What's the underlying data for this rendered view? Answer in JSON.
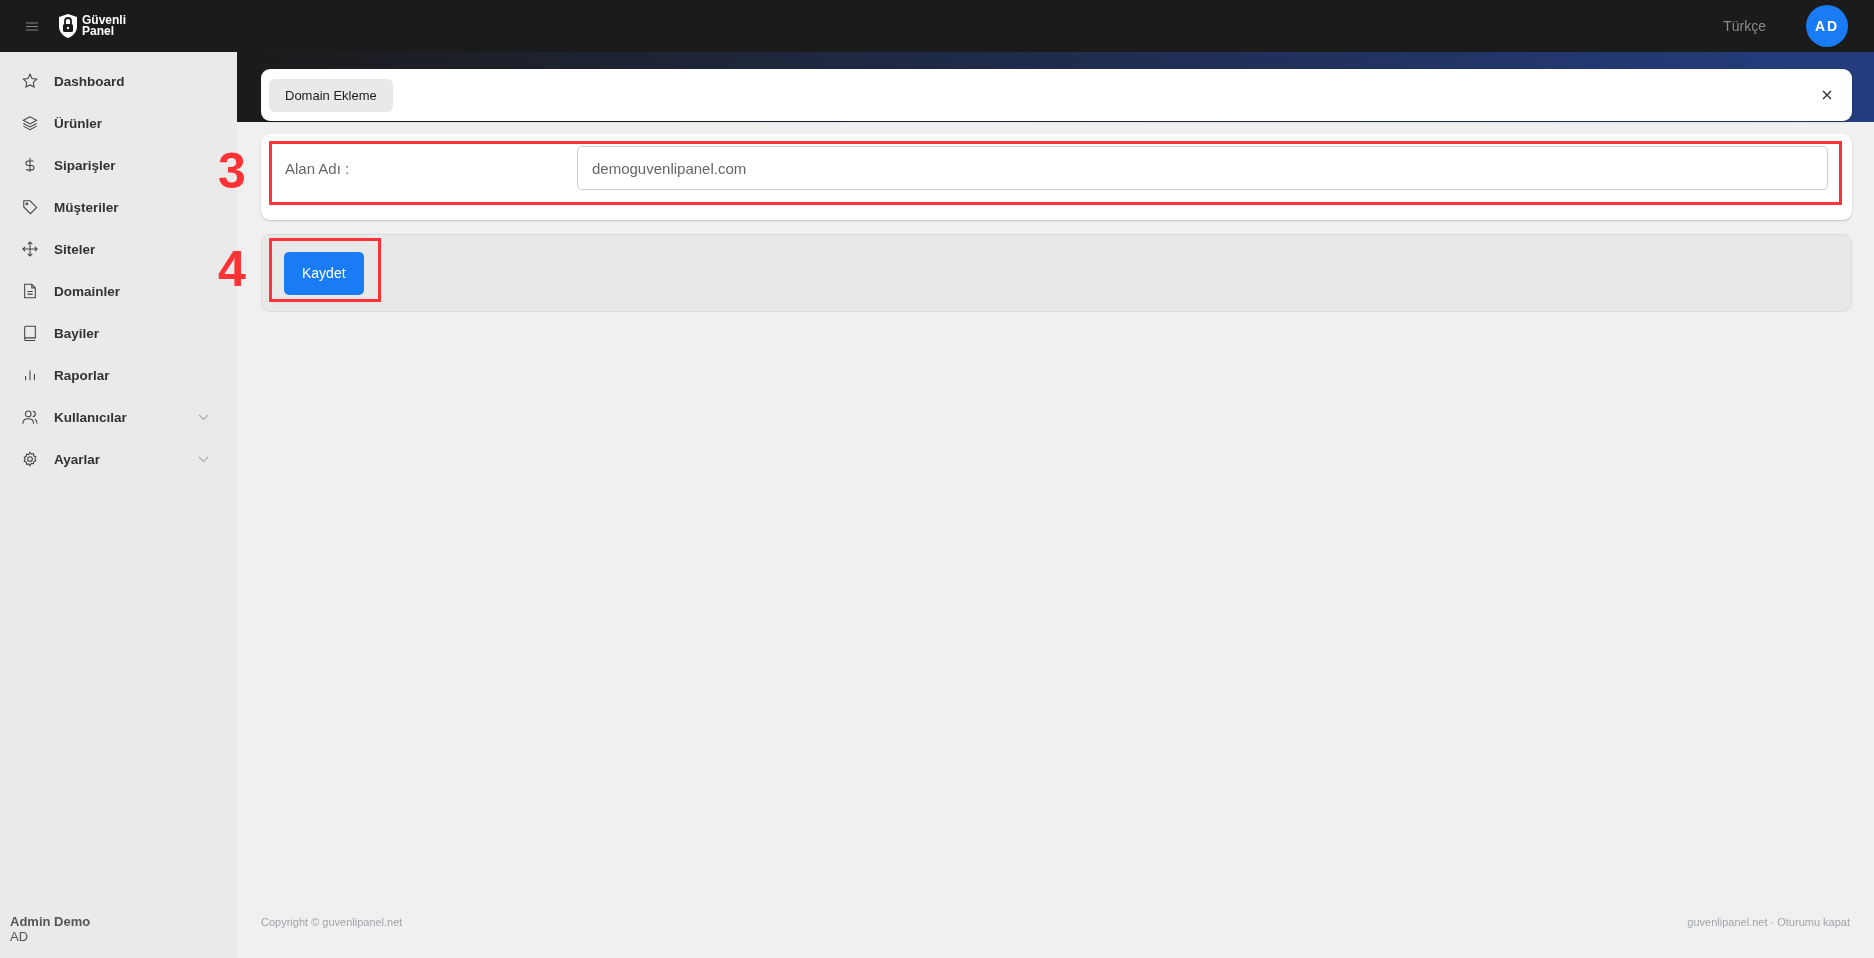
{
  "topbar": {
    "logo": [
      "Güvenli",
      "Panel"
    ],
    "language": "Türkçe",
    "avatar": "AD"
  },
  "sidebar": {
    "items": [
      {
        "label": "Dashboard",
        "selected": false
      },
      {
        "label": "Ürünler",
        "selected": false
      },
      {
        "label": "Siparişler",
        "selected": false
      },
      {
        "label": "Müşteriler",
        "selected": false
      },
      {
        "label": "Siteler",
        "selected": false
      },
      {
        "label": "Domainler",
        "selected": false
      },
      {
        "label": "Bayiler",
        "selected": false
      },
      {
        "label": "Raporlar",
        "selected": false
      },
      {
        "label": "Kullanıcılar",
        "selected": false,
        "expanded": false
      },
      {
        "label": "Ayarlar",
        "selected": false,
        "expanded": false
      }
    ],
    "user": {
      "name": "Admin Demo",
      "initials": "AD"
    }
  },
  "tab": {
    "label": "Domain Ekleme"
  },
  "form": {
    "label": "Alan Adı :",
    "value": "demoguvenlipanel.com"
  },
  "save_button": "Kaydet",
  "annotations": [
    {
      "number": "3"
    },
    {
      "number": "4"
    }
  ],
  "footer": {
    "copyright": "Copyright © guvenlipanel.net",
    "links": [
      "guvenlipanel.net",
      "Oturumu kapat"
    ],
    "separator": "·"
  }
}
